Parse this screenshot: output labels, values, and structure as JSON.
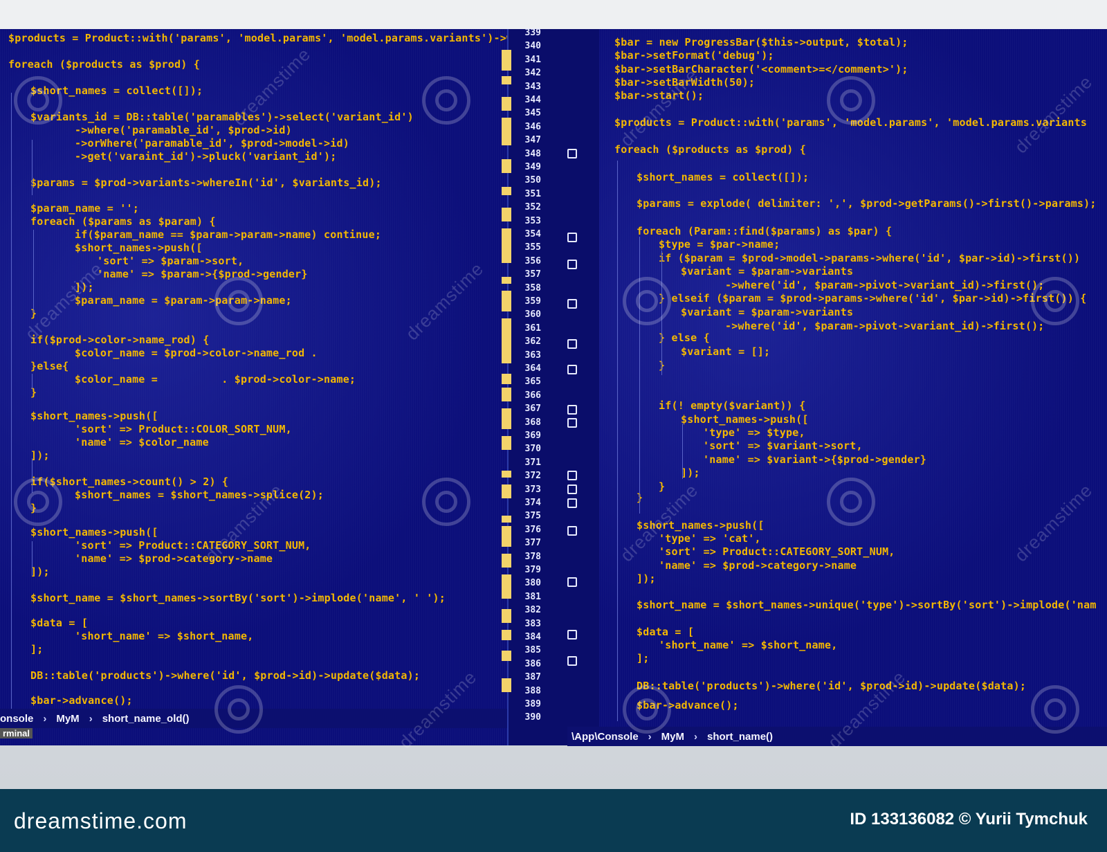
{
  "footer": {
    "logo_text": "dreamstime.com",
    "id_text": "ID 133136082 © Yurii Tymchuk"
  },
  "watermark_text": "dreamstime",
  "left_code": [
    "$products = Product::with('params', 'model.params', 'model.params.variants')->wher",
    "foreach ($products as $prod) {",
    "  $short_names = collect([]);",
    "  $variants_id = DB::table('paramables')->select('variant_id')",
    "      ->where('paramable_id', $prod->id)",
    "      ->orWhere('paramable_id', $prod->model->id)",
    "      ->get('varaint_id')->pluck('variant_id');",
    "  $params = $prod->variants->whereIn('id', $variants_id);",
    "  $param_name = '';",
    "  foreach ($params as $param) {",
    "      if($param_name == $param->param->name) continue;",
    "      $short_names->push([",
    "        'sort' => $param->sort,",
    "        'name' => $param->{$prod->gender}",
    "      ]);",
    "      $param_name = $param->param->name;",
    "  }",
    "  if($prod->color->name_rod) {",
    "      $color_name = $prod->color->name_rod .",
    "  }else{",
    "      $color_name =          . $prod->color->name;",
    "  }",
    "  $short_names->push([",
    "      'sort' => Product::COLOR_SORT_NUM,",
    "      'name' => $color_name",
    "  ]);",
    "  if($short_names->count() > 2) {",
    "      $short_names = $short_names->splice(2);",
    "  }",
    "  $short_names->push([",
    "      'sort' => Product::CATEGORY_SORT_NUM,",
    "      'name' => $prod->category->name",
    "  ]);",
    "  $short_name = $short_names->sortBy('sort')->implode('name', ' ');",
    "  $data = [",
    "      'short_name' => $short_name,",
    "  ];",
    "  DB::table('products')->where('id', $prod->id)->update($data);",
    "  $bar->advance();"
  ],
  "right_code": [
    "$bar = new ProgressBar($this->output, $total);",
    "$bar->setFormat('debug');",
    "$bar->setBarCharacter('<comment>=</comment>');",
    "$bar->setBarWidth(50);",
    "$bar->start();",
    "$products = Product::with('params', 'model.params', 'model.params.variants",
    "foreach ($products as $prod) {",
    "  $short_names = collect([]);",
    "  $params = explode( delimiter: ',', $prod->getParams()->first()->params);",
    "  foreach (Param::find($params) as $par) {",
    "    $type = $par->name;",
    "    if ($param = $prod->model->params->where('id', $par->id)->first())",
    "      $variant = $param->variants",
    "          ->where('id', $param->pivot->variant_id)->first();",
    "    } elseif ($param = $prod->params->where('id', $par->id)->first()) {",
    "      $variant = $param->variants",
    "          ->where('id', $param->pivot->variant_id)->first();",
    "    } else {",
    "      $variant = [];",
    "    }",
    "    if(! empty($variant)) {",
    "      $short_names->push([",
    "        'type' => $type,",
    "        'sort' => $variant->sort,",
    "        'name' => $variant->{$prod->gender}",
    "      ]);",
    "    }",
    "  }",
    "  $short_names->push([",
    "    'type' => 'cat',",
    "    'sort' => Product::CATEGORY_SORT_NUM,",
    "    'name' => $prod->category->name",
    "  ]);",
    "  $short_name = $short_names->unique('type')->sortBy('sort')->implode('nam",
    "  $data = [",
    "    'short_name' => $short_name,",
    "  ];",
    "  DB::table('products')->where('id', $prod->id)->update($data);",
    "  $bar->advance();"
  ],
  "line_numbers": [
    "339",
    "340",
    "341",
    "342",
    "343",
    "344",
    "345",
    "346",
    "347",
    "348",
    "349",
    "350",
    "351",
    "352",
    "353",
    "354",
    "355",
    "356",
    "357",
    "358",
    "359",
    "360",
    "361",
    "362",
    "363",
    "364",
    "365",
    "366",
    "367",
    "368",
    "369",
    "370",
    "371",
    "372",
    "373",
    "374",
    "375",
    "376",
    "377",
    "378",
    "379",
    "380",
    "381",
    "382",
    "383",
    "384",
    "385",
    "386",
    "387",
    "388",
    "389",
    "390"
  ],
  "left_breadcrumb": {
    "items": [
      "onsole",
      "MyM",
      "short_name_old()"
    ],
    "status": "rminal"
  },
  "right_breadcrumb": {
    "items": [
      "\\App\\Console",
      "MyM",
      "short_name()"
    ]
  },
  "colors": {
    "editor_bg": "#0b0e7a",
    "keyword": "#f3f3f3",
    "variable": "#ffb020",
    "string": "#7ee07e",
    "highlight": "#f5c400",
    "footer_bg": "#0a3b52"
  }
}
